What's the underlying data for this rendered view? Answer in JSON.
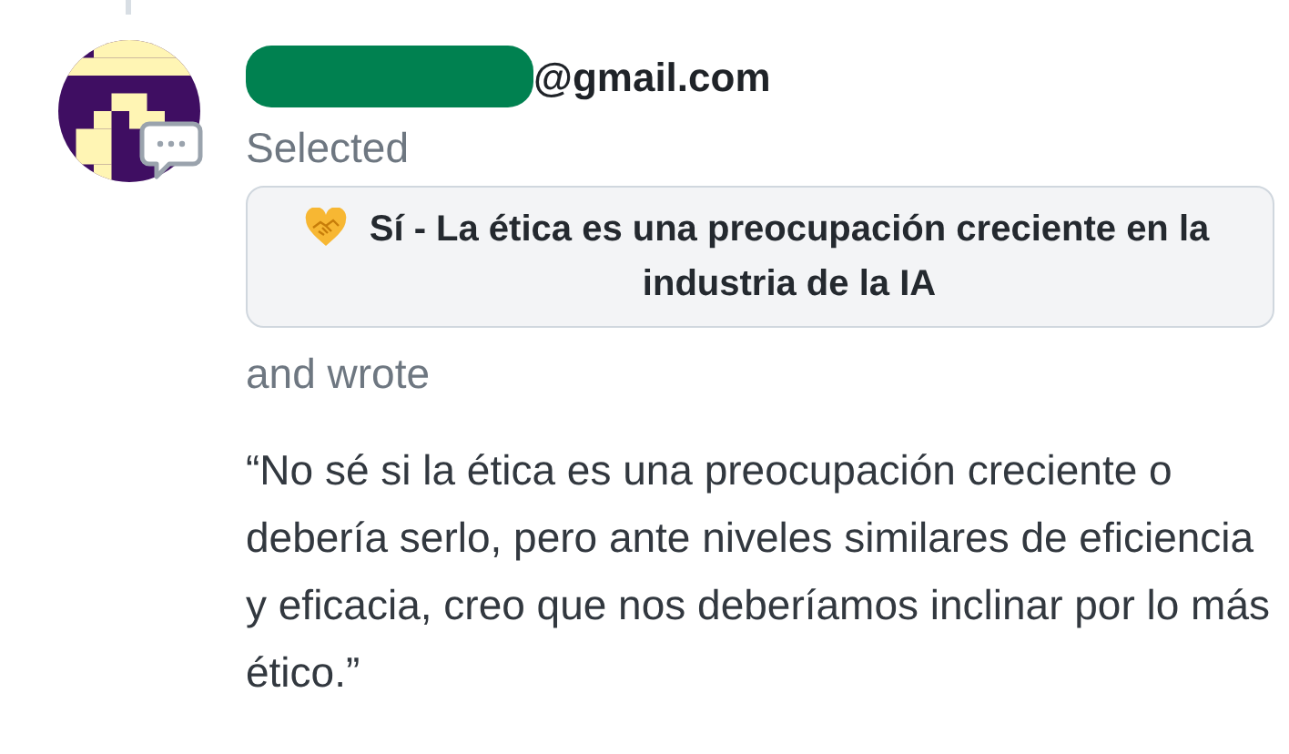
{
  "author": {
    "email_suffix": "@gmail.com",
    "redacted": true
  },
  "selection_label": "Selected",
  "selected_option": {
    "label": "Sí - La ética es una preocupación creciente en la industria de la IA"
  },
  "wrote_label": "and wrote",
  "comment": "“No sé si la ética es una preocupación creciente o debería serlo, pero ante niveles similares de eficiencia y eficacia, creo que nos deberíamos inclinar por lo más ético.”"
}
